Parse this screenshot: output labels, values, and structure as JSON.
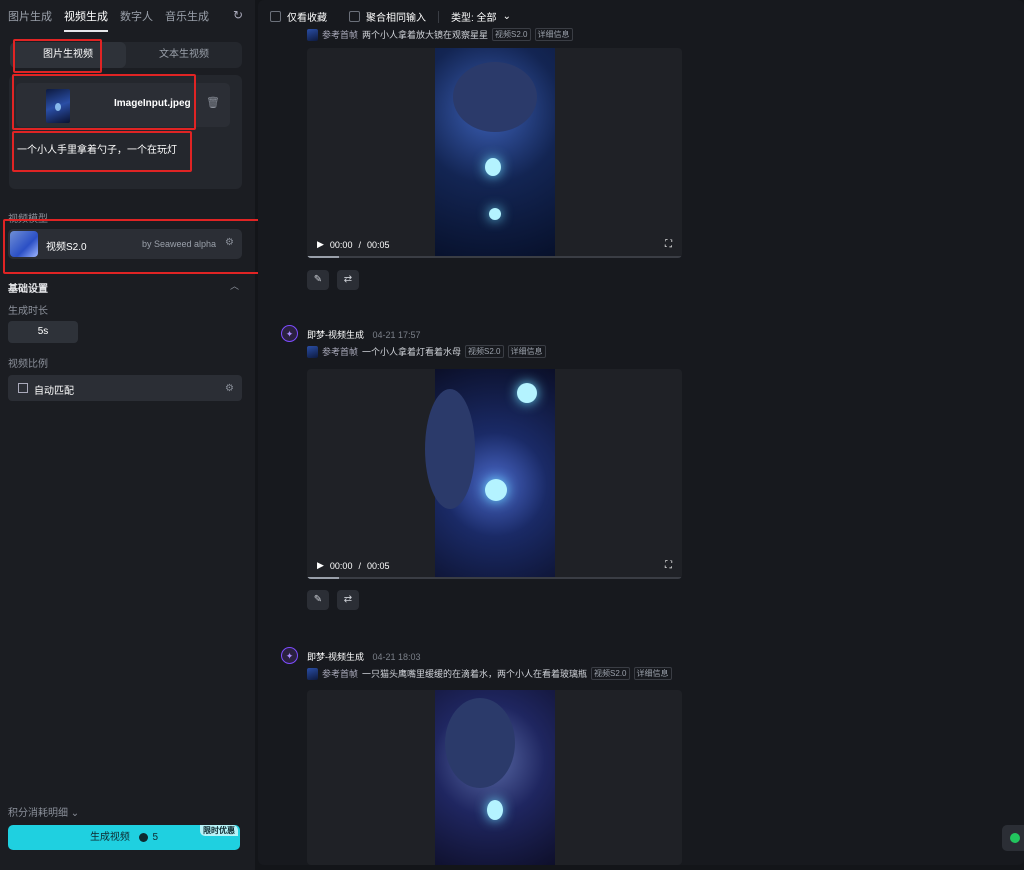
{
  "nav": {
    "tabs": [
      "图片生成",
      "视频生成",
      "数字人",
      "音乐生成"
    ],
    "active_index": 1,
    "history_icon": "refresh-icon"
  },
  "mode": {
    "image_to_video": "图片生视频",
    "text_to_video": "文本生视频"
  },
  "input": {
    "file_name": "ImageInput.jpeg",
    "prompt": "一个小人手里拿着勺子，一个在玩灯"
  },
  "model": {
    "section_label": "视频模型",
    "name": "视频S2.0",
    "by": "by Seaweed alpha"
  },
  "basic": {
    "title": "基础设置",
    "duration_label": "生成时长",
    "duration_value": "5s",
    "ratio_label": "视频比例",
    "ratio_value": "自动匹配"
  },
  "footer": {
    "credits_label": "积分消耗明细",
    "generate_label": "生成视频",
    "cost": "5",
    "badge": "限时优惠"
  },
  "filters": {
    "favorites_only": "仅看收藏",
    "merge_inputs": "聚合相同输入",
    "type_label": "类型: 全部"
  },
  "posts": [
    {
      "author": "",
      "time": "",
      "ref_label": "参考首帧",
      "prompt": "两个小人拿着放大镜在观察星星",
      "model_tag": "视频S2.0",
      "detail_tag": "详细信息",
      "current": "00:00",
      "duration": "00:05"
    },
    {
      "author": "即梦-视频生成",
      "time": "04-21  17:57",
      "ref_label": "参考首帧",
      "prompt": "一个小人拿着灯看着水母",
      "model_tag": "视频S2.0",
      "detail_tag": "详细信息",
      "current": "00:00",
      "duration": "00:05"
    },
    {
      "author": "即梦-视频生成",
      "time": "04-21  18:03",
      "ref_label": "参考首帧",
      "prompt": "一只猫头鹰嘴里缓缓的在滴着水，两个小人在看着玻璃瓶",
      "model_tag": "视频S2.0",
      "detail_tag": "详细信息"
    }
  ],
  "colors": {
    "accent": "#1fd0e0",
    "highlight_box": "#e02424",
    "avatar_purple": "#7d4cff"
  }
}
